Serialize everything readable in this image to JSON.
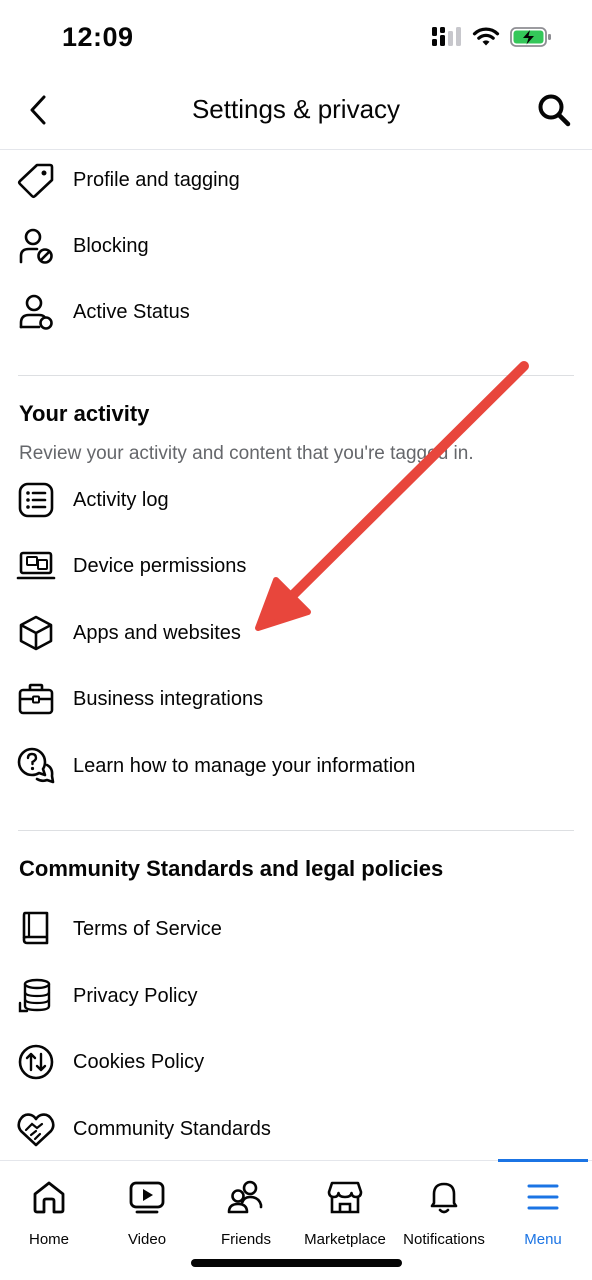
{
  "status_bar": {
    "time": "12:09"
  },
  "header": {
    "title": "Settings & privacy"
  },
  "privacy_items": [
    {
      "label": "Profile and tagging",
      "icon": "tag-icon"
    },
    {
      "label": "Blocking",
      "icon": "user-block-icon"
    },
    {
      "label": "Active Status",
      "icon": "user-status-icon"
    }
  ],
  "activity_section": {
    "title": "Your activity",
    "subtitle": "Review your activity and content that you're tagged in.",
    "items": [
      {
        "label": "Activity log",
        "icon": "list-icon"
      },
      {
        "label": "Device permissions",
        "icon": "devices-icon"
      },
      {
        "label": "Apps and websites",
        "icon": "cube-icon"
      },
      {
        "label": "Business integrations",
        "icon": "briefcase-icon"
      },
      {
        "label": "Learn how to manage your information",
        "icon": "question-chat-icon"
      }
    ]
  },
  "legal_section": {
    "title": "Community Standards and legal policies",
    "items": [
      {
        "label": "Terms of Service",
        "icon": "book-icon"
      },
      {
        "label": "Privacy Policy",
        "icon": "database-icon"
      },
      {
        "label": "Cookies Policy",
        "icon": "cookie-arrows-icon"
      },
      {
        "label": "Community Standards",
        "icon": "handshake-heart-icon"
      }
    ]
  },
  "annotation": {
    "arrow_color": "#e8463c"
  },
  "tabbar": {
    "active_color": "#1b74e4",
    "tabs": [
      {
        "label": "Home",
        "icon": "home-icon"
      },
      {
        "label": "Video",
        "icon": "video-icon"
      },
      {
        "label": "Friends",
        "icon": "friends-icon"
      },
      {
        "label": "Marketplace",
        "icon": "marketplace-icon"
      },
      {
        "label": "Notifications",
        "icon": "bell-icon"
      },
      {
        "label": "Menu",
        "icon": "menu-icon",
        "active": true
      }
    ]
  }
}
